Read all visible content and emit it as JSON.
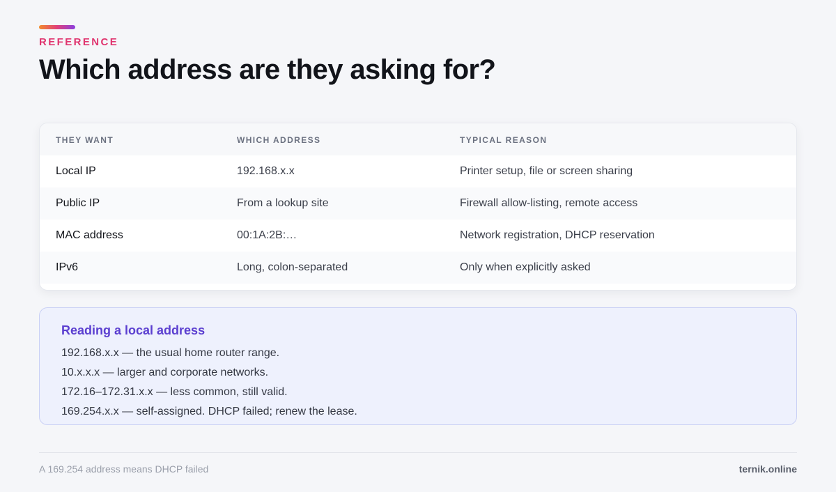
{
  "header": {
    "eyebrow": "REFERENCE",
    "title": "Which address are they asking for?"
  },
  "table": {
    "columns": [
      "THEY WANT",
      "WHICH ADDRESS",
      "TYPICAL REASON"
    ],
    "rows": [
      [
        "Local IP",
        "192.168.x.x",
        "Printer setup, file or screen sharing"
      ],
      [
        "Public IP",
        "From a lookup site",
        "Firewall allow-listing, remote access"
      ],
      [
        "MAC address",
        "00:1A:2B:…",
        "Network registration, DHCP reservation"
      ],
      [
        "IPv6",
        "Long, colon-separated",
        "Only when explicitly asked"
      ]
    ]
  },
  "note": {
    "title": "Reading a local address",
    "lines": [
      "192.168.x.x — the usual home router range.",
      "10.x.x.x — larger and corporate networks.",
      "172.16–172.31.x.x — less common, still valid.",
      "169.254.x.x — self-assigned. DHCP failed; renew the lease."
    ]
  },
  "footer": {
    "caption": "A 169.254 address means DHCP failed",
    "brand": "ternik.online"
  },
  "colors": {
    "eyebrow": "#e0356f",
    "note_title": "#5b3fd0",
    "note_background": "#eef1fd"
  }
}
